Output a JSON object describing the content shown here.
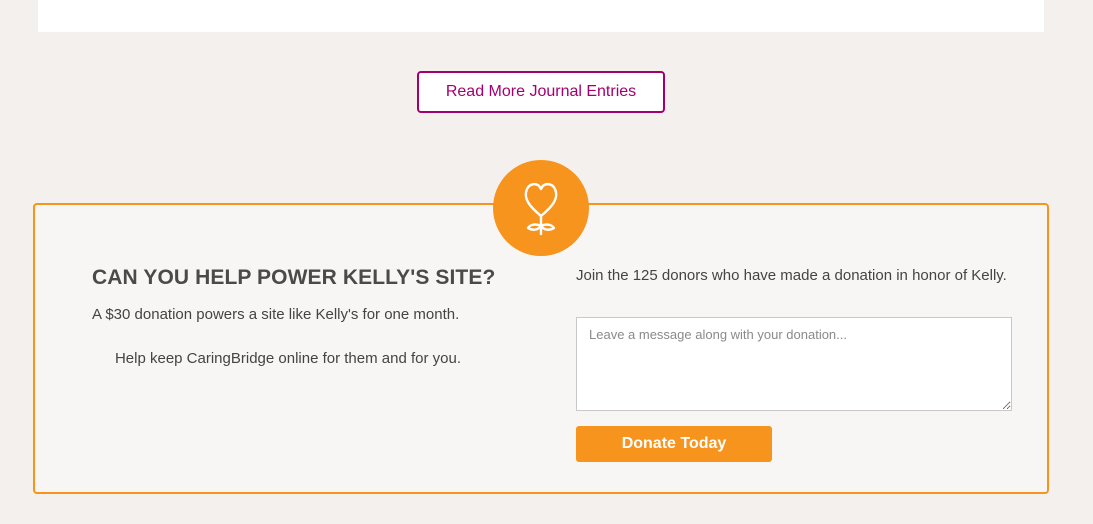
{
  "journal": {
    "read_more_label": "Read More Journal Entries"
  },
  "donation": {
    "icon": "heart-flower-icon",
    "heading": "CAN YOU HELP POWER KELLY'S SITE?",
    "subtext": "A $30 donation powers a site like Kelly's for one month.",
    "appeal": "Help keep CaringBridge online for them and for you.",
    "donor_text": "Join the 125 donors who have made a donation in honor of Kelly.",
    "message_placeholder": "Leave a message along with your donation...",
    "message_value": "",
    "donate_label": "Donate Today"
  },
  "colors": {
    "accent_orange": "#f7941d",
    "accent_magenta": "#a3006f",
    "page_background": "#f4f0ed",
    "panel_background": "#f8f6f4"
  }
}
